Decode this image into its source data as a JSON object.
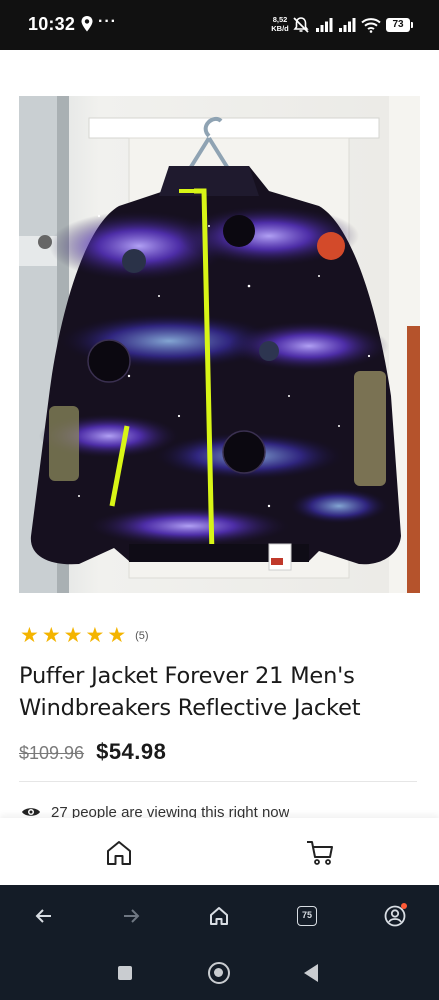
{
  "status_bar": {
    "time": "10:32",
    "more": "···",
    "net_speed_value": "8,52",
    "net_speed_unit": "KB/d",
    "battery": "73",
    "icons": [
      "location-icon",
      "mute-icon",
      "signal-icon",
      "signal-icon",
      "wifi-icon",
      "battery-icon"
    ]
  },
  "product": {
    "image_alt_icon": "space-print-jacket",
    "rating": 5,
    "review_count": "(5)",
    "title": "Puffer Jacket Forever 21 Men's Windbreakers Reflective Jacket",
    "old_price": "$109.96",
    "price": "$54.98",
    "viewing_text": "27 people are viewing this right now"
  },
  "app_bar": {
    "items": [
      "home-icon",
      "cart-icon"
    ]
  },
  "browser_bar": {
    "tab_count": "75",
    "items": [
      "back-icon",
      "forward-icon",
      "home-icon",
      "tabs-icon",
      "account-icon"
    ]
  },
  "colors": {
    "star": "#f4b400",
    "status_bar": "#111111",
    "browser_bar": "#141c27",
    "jacket_zip": "#d8f516"
  }
}
